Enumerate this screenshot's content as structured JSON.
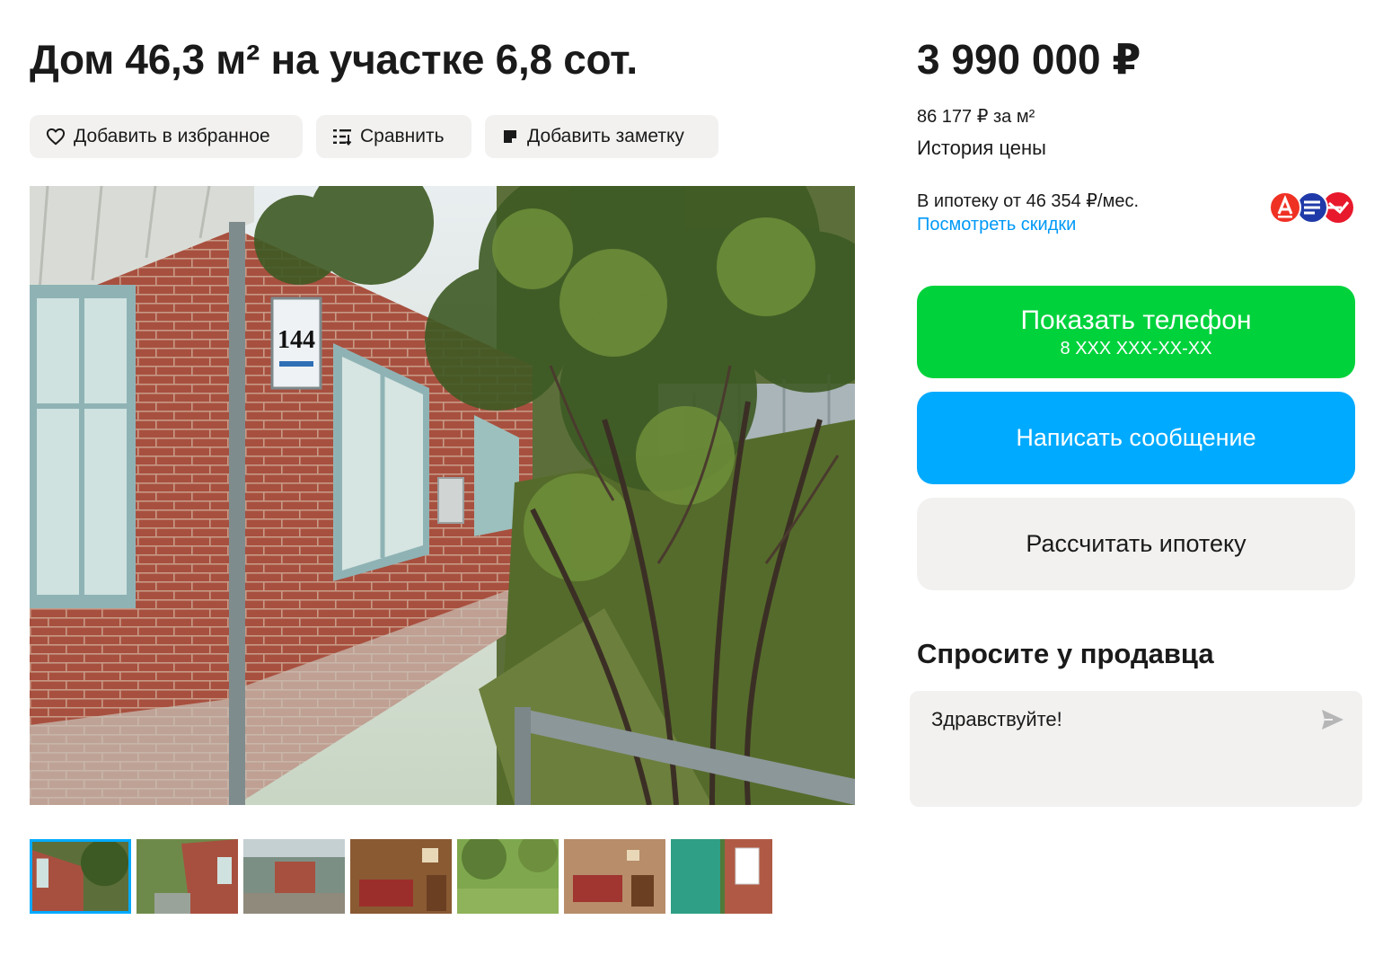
{
  "listing": {
    "title": "Дом 46,3 м² на участке 6,8 сот.",
    "price": "3 990 000 ₽",
    "price_per_m": "86 177 ₽ за м²",
    "price_history_label": "История цены"
  },
  "actions": {
    "favorite_label": "Добавить в избранное",
    "compare_label": "Сравнить",
    "note_label": "Добавить заметку"
  },
  "gallery": {
    "house_number": "144",
    "thumbnail_count": 7,
    "active_thumbnail": 1
  },
  "mortgage": {
    "offer_text": "В ипотеку от 46 354 ₽/мес.",
    "discounts_link": "Посмотреть скидки",
    "bank_icons": [
      "alfa-bank-logo-icon",
      "bank-logo-icon",
      "bank-arrow-logo-icon"
    ]
  },
  "contact": {
    "show_phone_label": "Показать телефон",
    "phone_masked": "8 XXX XXX-XX-XX",
    "write_message_label": "Написать сообщение",
    "calc_mortgage_label": "Рассчитать ипотеку"
  },
  "ask_seller": {
    "title": "Спросите у продавца",
    "message_text": "Здравствуйте!"
  },
  "colors": {
    "green_button": "#00d23c",
    "blue_button": "#00aaff",
    "link": "#0099f7",
    "gray_surface": "#f2f1f0"
  }
}
